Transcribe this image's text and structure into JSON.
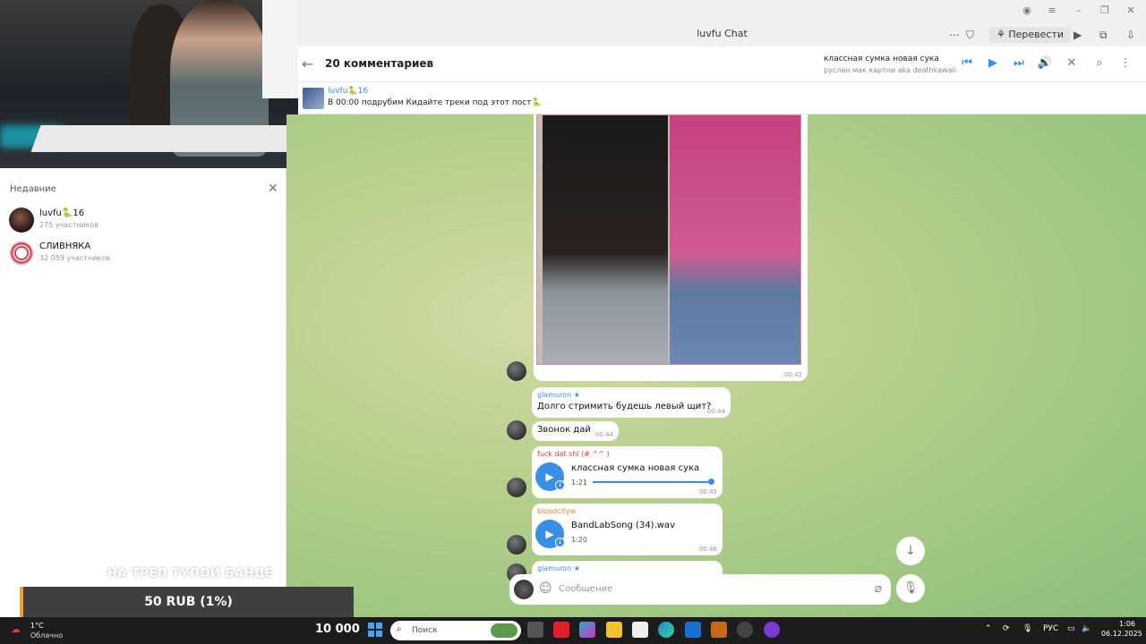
{
  "window": {
    "title": "luvfu Chat",
    "translate_label": "Перевести"
  },
  "chat_header": {
    "title": "20 комментариев",
    "now_playing": {
      "title": "классная сумка новая сука",
      "artist": "руслан мак картни aka deathkawaii"
    }
  },
  "pinned": {
    "channel": "luvfu🐍16",
    "text": "В 00:00 подрубим Кидайте треки под этот пост🐍"
  },
  "sidebar": {
    "title": "Недавние",
    "items": [
      {
        "name": "luvfu🐍16",
        "subtitle": "275 участников"
      },
      {
        "name": "СЛИВНЯКА",
        "subtitle": "32 059 участников"
      }
    ]
  },
  "messages": {
    "photo_time": "00:42",
    "m1": {
      "sender": "glamuron ★",
      "text": "Долго стримить будешь левый щит?",
      "time": "00:44"
    },
    "m2": {
      "text": "Звонок дай",
      "time": "00:44"
    },
    "m3": {
      "sender": "fuck dat shi (# ^^ )",
      "title": "классная сумка новая сука",
      "duration": "1:21",
      "time": "00:45",
      "progress": 1.0
    },
    "m4": {
      "sender": "bloodcityw",
      "title": "BandLabSong (34).wav",
      "duration": "1:20",
      "time": "00:46"
    },
    "m5": {
      "sender": "glamuron ★"
    }
  },
  "composer": {
    "placeholder": "Сообщение"
  },
  "overlay": {
    "stream_text": "НА ТРЕП ТУПОЙ БАНДЕ",
    "donation": "50 RUB (1%)"
  },
  "taskbar": {
    "temperature": "1°C",
    "weather": "Облачно",
    "counter": "10 000",
    "search_placeholder": "Поиск",
    "language": "РУС",
    "time": "1:06",
    "date": "06.12.2025"
  },
  "colors": {
    "accent": "#3a8ee6",
    "donation_bar": "#f0a030",
    "taskbar": "#1c1c1c"
  }
}
